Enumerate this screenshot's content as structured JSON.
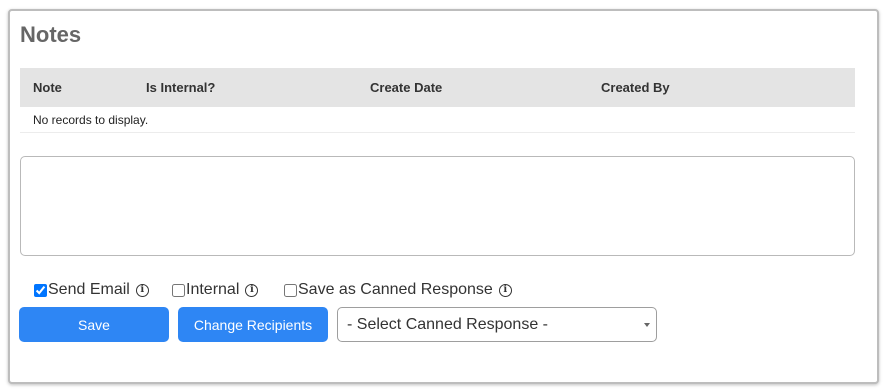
{
  "notes": {
    "title": "Notes",
    "columns": [
      "Note",
      "Is Internal?",
      "Create Date",
      "Created By"
    ],
    "empty_message": "No records to display.",
    "note_text": "",
    "options": [
      {
        "label": "Send Email",
        "checked": true
      },
      {
        "label": "Internal",
        "checked": false
      },
      {
        "label": "Save as Canned Response",
        "checked": false
      }
    ],
    "buttons": {
      "save": "Save",
      "change_recipients": "Change Recipients"
    },
    "canned_select": {
      "selected": "- Select Canned Response -"
    }
  },
  "colors": {
    "primary_button": "#2e86f4",
    "grid_header": "#e4e4e4",
    "title": "#666666"
  }
}
